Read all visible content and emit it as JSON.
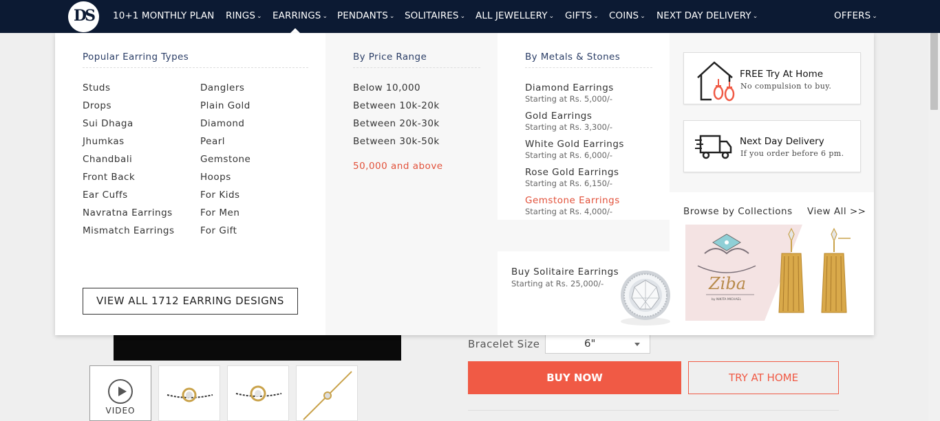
{
  "nav": {
    "logo_text": "DS",
    "items": [
      "10+1 MONTHLY PLAN",
      "RINGS",
      "EARRINGS",
      "PENDANTS",
      "SOLITAIRES",
      "ALL JEWELLERY",
      "GIFTS",
      "COINS",
      "NEXT DAY DELIVERY",
      "OFFERS"
    ],
    "active": "EARRINGS"
  },
  "menu": {
    "types": {
      "heading": "Popular Earring Types",
      "col1": [
        "Studs",
        "Drops",
        "Sui Dhaga",
        "Jhumkas",
        "Chandbali",
        "Front Back",
        "Ear Cuffs",
        "Navratna Earrings",
        "Mismatch Earrings"
      ],
      "col2": [
        "Danglers",
        "Plain Gold",
        "Diamond",
        "Pearl",
        "Gemstone",
        "Hoops",
        "For Kids",
        "For Men",
        "For Gift"
      ],
      "view_all": "VIEW ALL 1712 EARRING DESIGNS"
    },
    "price": {
      "heading": "By Price Range",
      "items": [
        "Below 10,000",
        "Between 10k-20k",
        "Between 20k-30k",
        "Between 30k-50k",
        "50,000 and above"
      ],
      "highlighted": "50,000 and above"
    },
    "metals": {
      "heading": "By Metals & Stones",
      "items": [
        {
          "label": "Diamond Earrings",
          "sub": "Starting at Rs. 5,000/-"
        },
        {
          "label": "Gold Earrings",
          "sub": "Starting at Rs. 3,300/-"
        },
        {
          "label": "White Gold Earrings",
          "sub": "Starting at Rs. 6,000/-"
        },
        {
          "label": "Rose Gold Earrings",
          "sub": "Starting at Rs. 6,150/-"
        },
        {
          "label": "Gemstone Earrings",
          "sub": "Starting at Rs. 4,000/-"
        }
      ],
      "highlighted": "Gemstone Earrings"
    },
    "solitaire": {
      "title": "Buy Solitaire Earrings",
      "sub": "Starting at Rs. 25,000/-"
    },
    "features": [
      {
        "title": "FREE Try At Home",
        "sub": "No compulsion to buy.",
        "icon": "house-earring-icon"
      },
      {
        "title": "Next Day Delivery",
        "sub": "If you order before 6 pm.",
        "icon": "delivery-truck-icon"
      }
    ],
    "collections": {
      "heading": "Browse by Collections",
      "view_all": "View All >>",
      "collection_name": "Ziba",
      "collection_sub": "by NIKITA MICHAEL"
    }
  },
  "page": {
    "video_label": "VIDEO",
    "bracelet_size_label": "Bracelet Size",
    "bracelet_size_value": "6\"",
    "buy_now": "BUY NOW",
    "try_at_home": "TRY AT HOME"
  },
  "colors": {
    "nav_bg": "#0c1a33",
    "accent": "#f05a45",
    "heading": "#2a3d66"
  }
}
